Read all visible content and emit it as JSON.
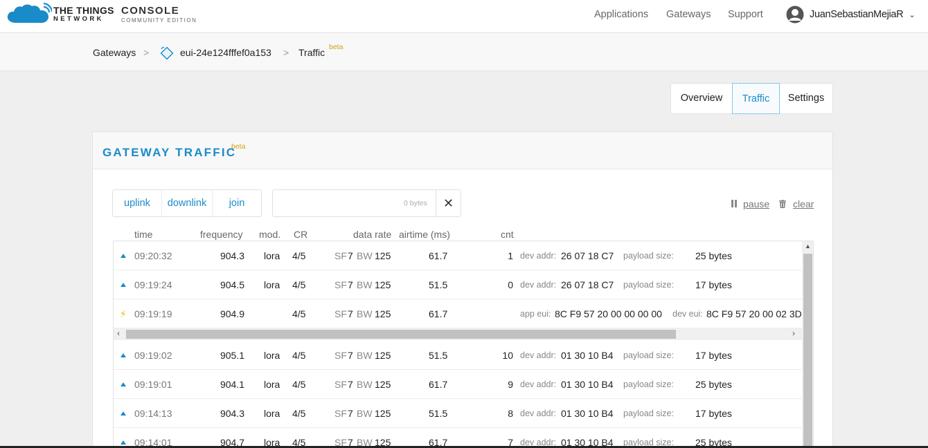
{
  "header": {
    "brand_line1": "THE THINGS",
    "brand_line2": "NETWORK",
    "console_line1": "CONSOLE",
    "console_line2": "COMMUNITY EDITION",
    "nav": [
      "Applications",
      "Gateways",
      "Support"
    ],
    "user": "JuanSebastianMejiaR"
  },
  "breadcrumb": {
    "gateways": "Gateways",
    "separator": ">",
    "gateway_id": "eui-24e124fffef0a153",
    "traffic": "Traffic",
    "beta": "beta"
  },
  "tabs": [
    "Overview",
    "Traffic",
    "Settings"
  ],
  "card": {
    "title": "GATEWAY TRAFFIC",
    "beta": "beta",
    "filters": [
      "uplink",
      "downlink",
      "join"
    ],
    "search": {
      "value": "",
      "bytes_label": "0 bytes",
      "clear_icon": "✕"
    },
    "pause": "pause",
    "clear": "clear",
    "columns": {
      "time": "time",
      "frequency": "frequency",
      "mod": "mod.",
      "cr": "CR",
      "data_rate": "data rate",
      "airtime": "airtime (ms)",
      "cnt": "cnt"
    },
    "labels": {
      "sf": "SF",
      "bw": "BW",
      "dev_addr": "dev addr:",
      "payload_size": "payload size:",
      "app_eui": "app eui:",
      "dev_eui": "dev eui:"
    },
    "rows": [
      {
        "type": "uplink",
        "time": "09:20:32",
        "freq": "904.3",
        "mod": "lora",
        "cr": "4/5",
        "sf": "7",
        "bw": "125",
        "airtime": "61.7",
        "cnt": "1",
        "dev_addr": "26 07 18 C7",
        "payload": "25 bytes"
      },
      {
        "type": "uplink",
        "time": "09:19:24",
        "freq": "904.5",
        "mod": "lora",
        "cr": "4/5",
        "sf": "7",
        "bw": "125",
        "airtime": "51.5",
        "cnt": "0",
        "dev_addr": "26 07 18 C7",
        "payload": "17 bytes"
      },
      {
        "type": "join",
        "time": "09:19:19",
        "freq": "904.9",
        "mod": "",
        "cr": "4/5",
        "sf": "7",
        "bw": "125",
        "airtime": "61.7",
        "app_eui": "8C F9 57 20 00 00 00 00",
        "dev_eui": "8C F9 57 20 00 02 3D"
      },
      {
        "type": "uplink",
        "time": "09:19:02",
        "freq": "905.1",
        "mod": "lora",
        "cr": "4/5",
        "sf": "7",
        "bw": "125",
        "airtime": "51.5",
        "cnt": "10",
        "dev_addr": "01 30 10 B4",
        "payload": "17 bytes"
      },
      {
        "type": "uplink",
        "time": "09:19:01",
        "freq": "904.1",
        "mod": "lora",
        "cr": "4/5",
        "sf": "7",
        "bw": "125",
        "airtime": "61.7",
        "cnt": "9",
        "dev_addr": "01 30 10 B4",
        "payload": "25 bytes"
      },
      {
        "type": "uplink",
        "time": "09:14:13",
        "freq": "904.3",
        "mod": "lora",
        "cr": "4/5",
        "sf": "7",
        "bw": "125",
        "airtime": "51.5",
        "cnt": "8",
        "dev_addr": "01 30 10 B4",
        "payload": "17 bytes"
      },
      {
        "type": "uplink",
        "time": "09:14:01",
        "freq": "904.7",
        "mod": "lora",
        "cr": "4/5",
        "sf": "7",
        "bw": "125",
        "airtime": "61.7",
        "cnt": "7",
        "dev_addr": "01 30 10 B4",
        "payload": "25 bytes"
      }
    ]
  },
  "colors": {
    "accent": "#1a8bc9",
    "beta": "#d4a017",
    "join": "#f2b705"
  }
}
